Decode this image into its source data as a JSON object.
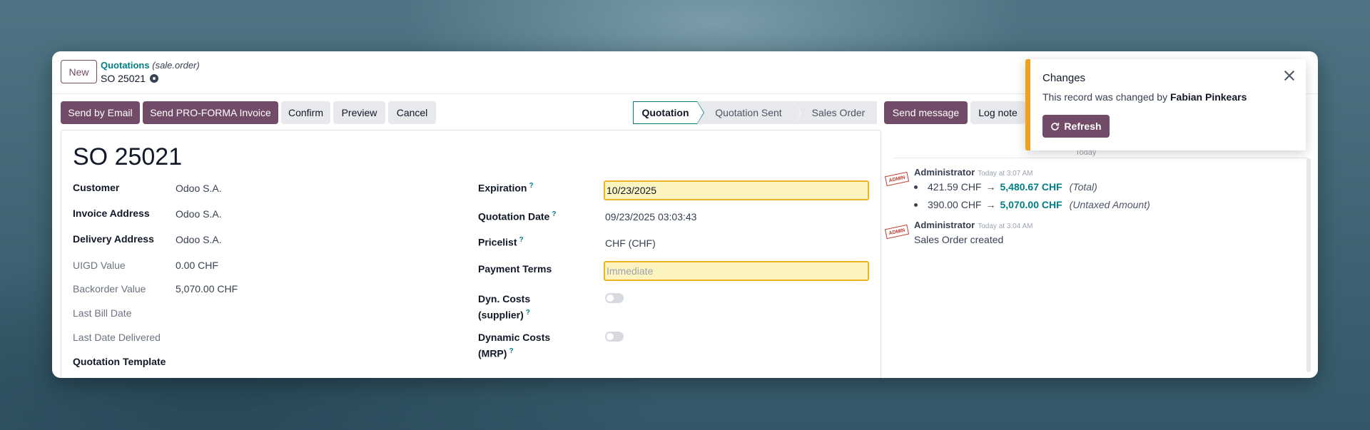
{
  "topbar": {
    "new_label": "New",
    "breadcrumb_link": "Quotations",
    "breadcrumb_model": "(sale.order)",
    "record_name": "SO 25021"
  },
  "actions": {
    "send_email": "Send by Email",
    "send_proforma": "Send PRO-FORMA Invoice",
    "confirm": "Confirm",
    "preview": "Preview",
    "cancel": "Cancel"
  },
  "statusbar": {
    "stages": [
      "Quotation",
      "Quotation Sent",
      "Sales Order"
    ],
    "active": "Quotation"
  },
  "chatter_actions": {
    "send_message": "Send message",
    "log_note": "Log note"
  },
  "form": {
    "title": "SO 25021",
    "left_fields": [
      {
        "label": "Customer",
        "value": "Odoo S.A."
      },
      {
        "label": "Invoice Address",
        "value": "Odoo S.A."
      },
      {
        "label": "Delivery Address",
        "value": "Odoo S.A."
      },
      {
        "label": "UIGD Value",
        "value": "0.00 CHF"
      },
      {
        "label": "Backorder Value",
        "value": "5,070.00 CHF"
      },
      {
        "label": "Last Bill Date",
        "value": ""
      },
      {
        "label": "Last Date Delivered",
        "value": ""
      },
      {
        "label": "Quotation Template",
        "value": ""
      }
    ],
    "right_fields": [
      {
        "label": "Expiration",
        "value": "10/23/2025"
      },
      {
        "label": "Quotation Date",
        "value": "09/23/2025 03:03:43"
      },
      {
        "label": "Pricelist",
        "value": "CHF (CHF)"
      },
      {
        "label": "Payment Terms",
        "placeholder": "Immediate"
      },
      {
        "label_line1": "Dyn. Costs",
        "label_line2": "(supplier)",
        "value": false
      },
      {
        "label_line1": "Dynamic Costs",
        "label_line2": "(MRP)",
        "value": false
      }
    ],
    "help_marker": "?"
  },
  "chatter": {
    "day_separator": "Today",
    "messages": [
      {
        "author": "Administrator",
        "time": "Today at 3:07 AM",
        "stamp": "ADMIN",
        "tracking": [
          {
            "old": "421.59 CHF",
            "arrow": "→",
            "new": "5,480.67 CHF",
            "field": "(Total)"
          },
          {
            "old": "390.00 CHF",
            "arrow": "→",
            "new": "5,070.00 CHF",
            "field": "(Untaxed Amount)"
          }
        ]
      },
      {
        "author": "Administrator",
        "time": "Today at 3:04 AM",
        "stamp": "ADMIN",
        "body": "Sales Order created"
      }
    ]
  },
  "notification": {
    "title": "Changes",
    "body_prefix": "This record was changed by",
    "body_user": "Fabian Pinkears",
    "button": "Refresh",
    "accent_color": "#f0a020"
  },
  "colors": {
    "brand": "#714b67",
    "link": "#017e84",
    "required_bg": "#fbf3c0",
    "required_border": "#f0b323"
  }
}
